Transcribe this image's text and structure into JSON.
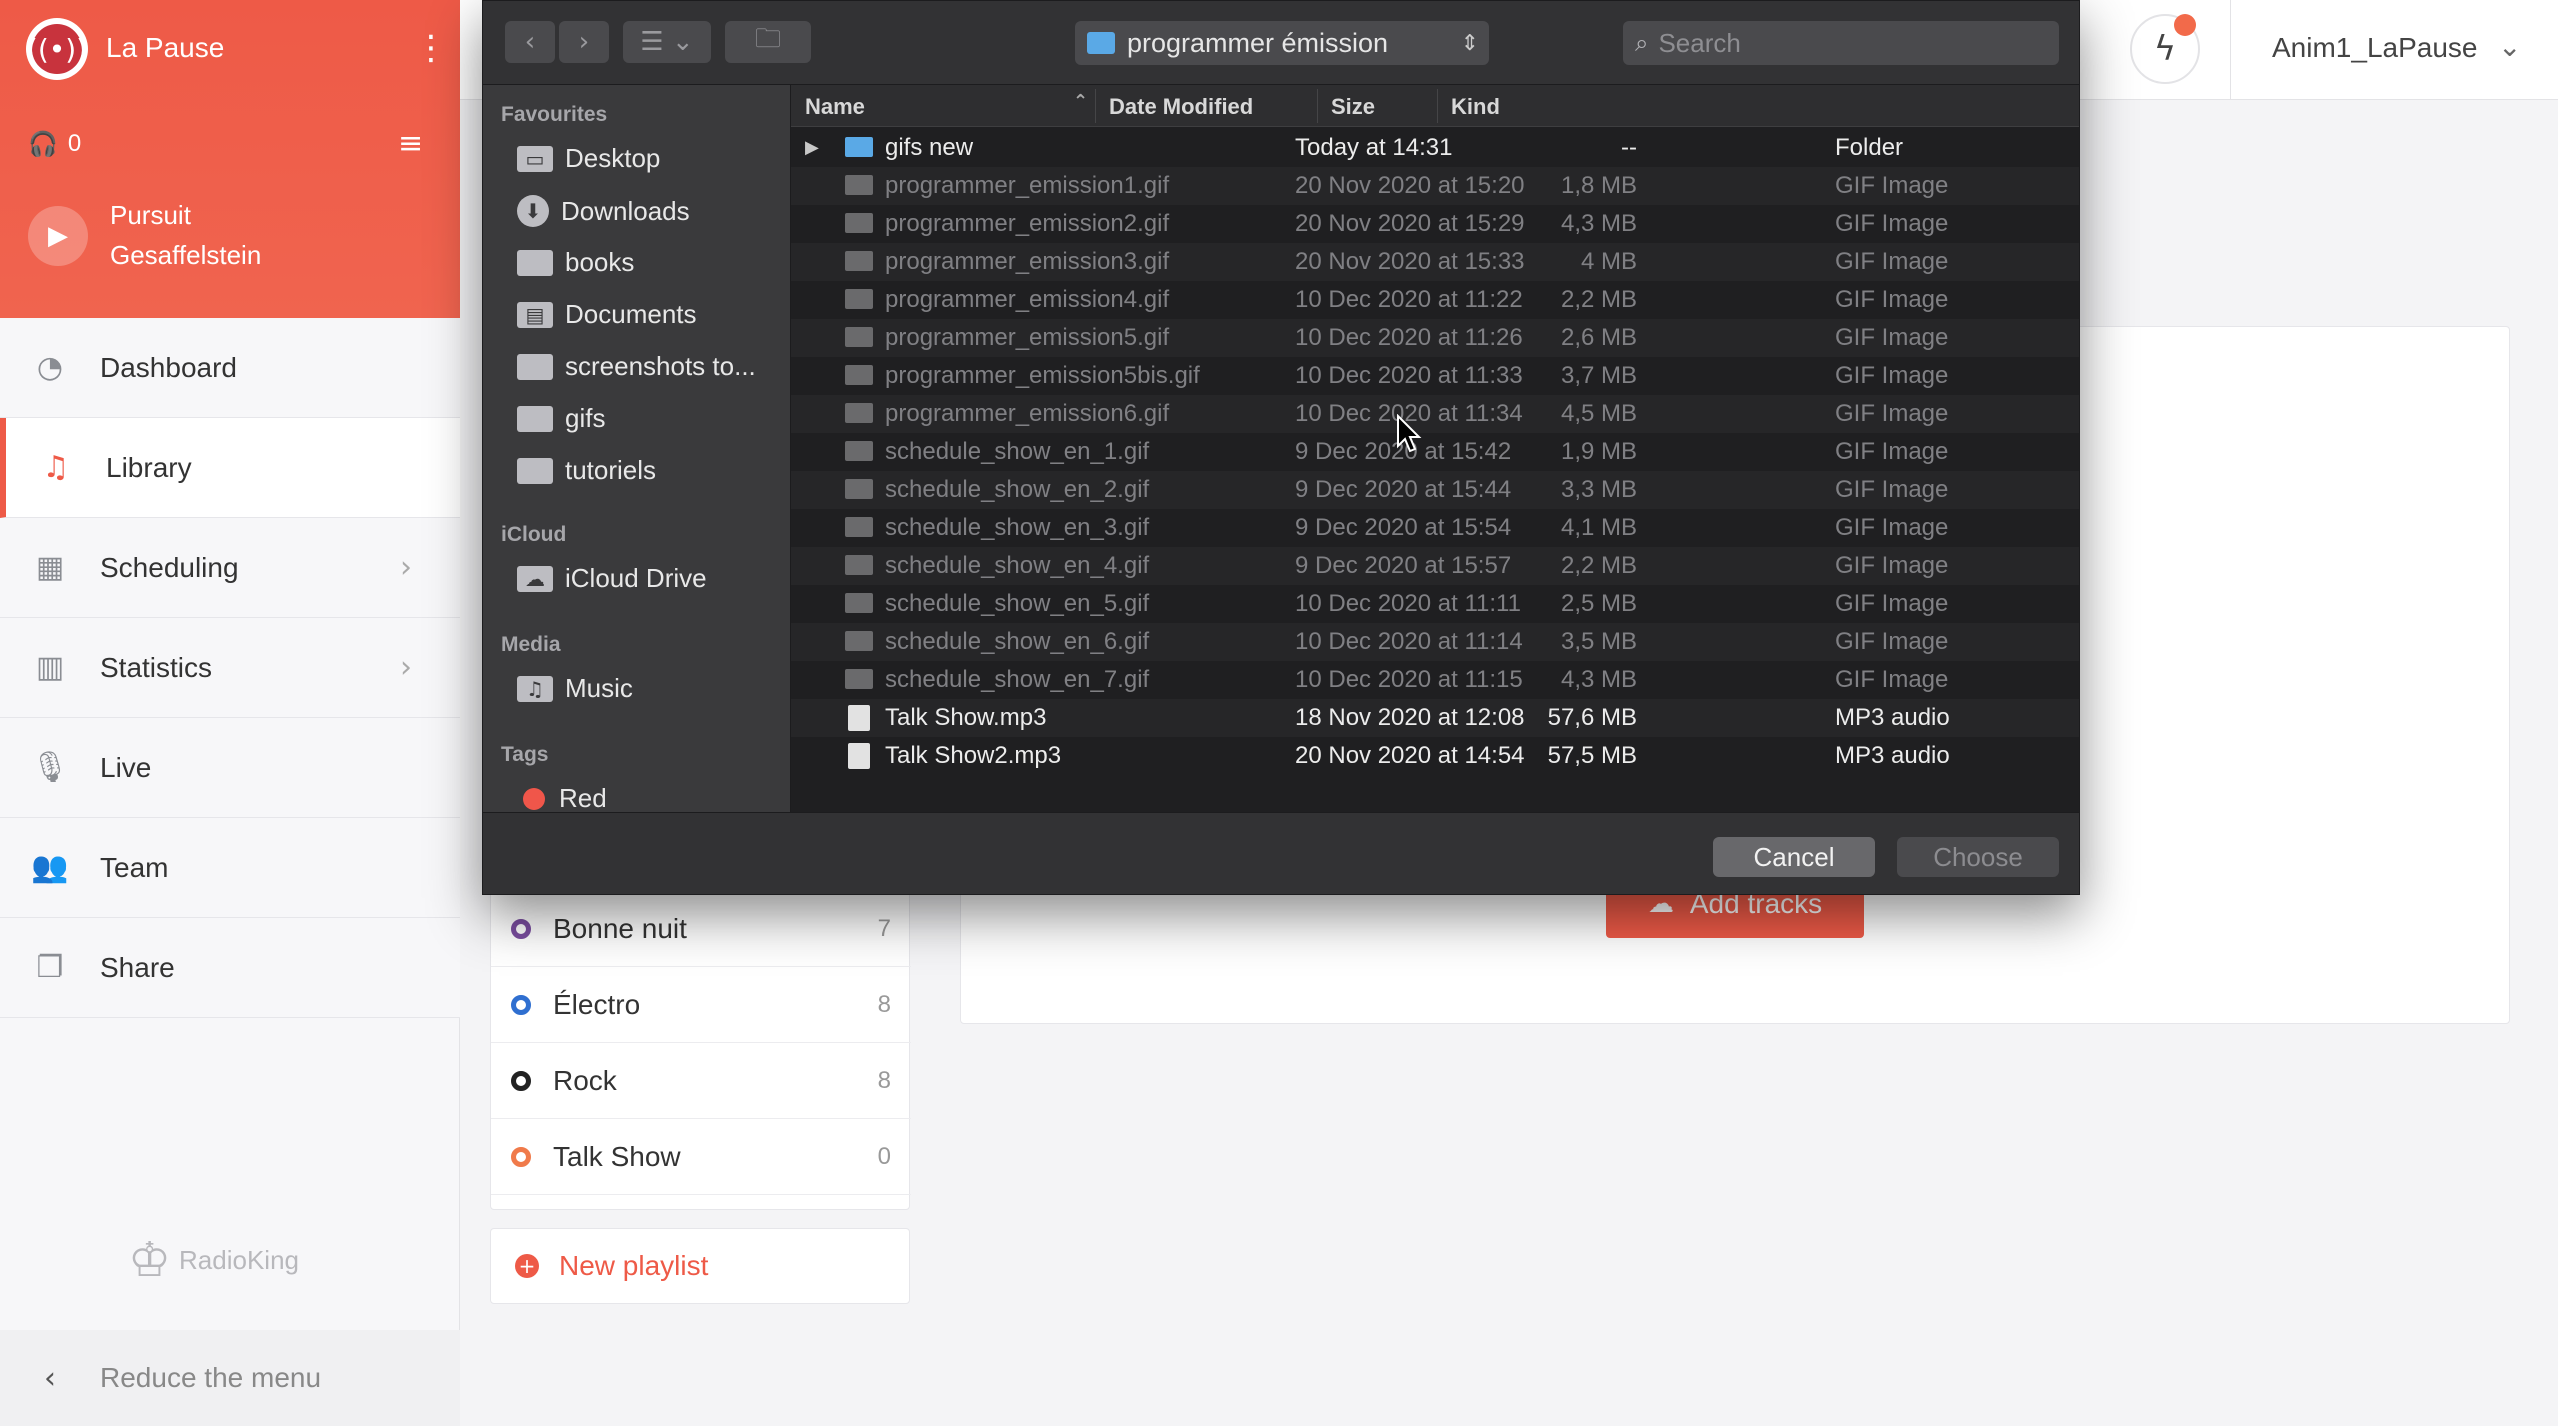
{
  "radio": {
    "name": "La Pause",
    "menu_icon": "⋮",
    "listeners": "0",
    "now_playing": {
      "title": "Pursuit",
      "artist": "Gesaffelstein"
    }
  },
  "sidebar": {
    "items": [
      {
        "label": "Dashboard",
        "icon": "gauge-icon",
        "glyph": "◔"
      },
      {
        "label": "Library",
        "icon": "music-note-icon",
        "glyph": "♫",
        "active": true
      },
      {
        "label": "Scheduling",
        "icon": "calendar-icon",
        "glyph": "▦",
        "chevron": true
      },
      {
        "label": "Statistics",
        "icon": "bar-chart-icon",
        "glyph": "▥",
        "chevron": true
      },
      {
        "label": "Live",
        "icon": "microphone-icon",
        "glyph": "🎙"
      },
      {
        "label": "Team",
        "icon": "users-icon",
        "glyph": "👥"
      },
      {
        "label": "Share",
        "icon": "share-icon",
        "glyph": "❐"
      }
    ],
    "brand": "RadioKing",
    "reduce_label": "Reduce the menu"
  },
  "topbar": {
    "user": "Anim1_LaPause"
  },
  "playlists": [
    {
      "name": "Bonne nuit",
      "count": "7",
      "color": "#7b4ea0"
    },
    {
      "name": "Électro",
      "count": "8",
      "color": "#2f6fd0"
    },
    {
      "name": "Rock",
      "count": "8",
      "color": "#222222"
    },
    {
      "name": "Talk Show",
      "count": "0",
      "color": "#f07a4a"
    }
  ],
  "new_playlist_label": "New playlist",
  "add_tracks_label": "Add tracks",
  "dialog": {
    "location": "programmer émission",
    "search_placeholder": "Search",
    "sidebar": {
      "favourites_title": "Favourites",
      "favourites": [
        "Desktop",
        "Downloads",
        "books",
        "Documents",
        "screenshots to...",
        "gifs",
        "tutoriels"
      ],
      "icloud_title": "iCloud",
      "icloud": [
        "iCloud Drive"
      ],
      "media_title": "Media",
      "media": [
        "Music"
      ],
      "tags_title": "Tags",
      "tags": [
        "Red"
      ]
    },
    "columns": {
      "name": "Name",
      "date": "Date Modified",
      "size": "Size",
      "kind": "Kind"
    },
    "files": [
      {
        "name": "gifs new",
        "date": "Today at 14:31",
        "size": "--",
        "kind": "Folder",
        "type": "folder",
        "enabled": true
      },
      {
        "name": "programmer_emission1.gif",
        "date": "20 Nov 2020 at 15:20",
        "size": "1,8 MB",
        "kind": "GIF Image",
        "type": "gif",
        "enabled": false
      },
      {
        "name": "programmer_emission2.gif",
        "date": "20 Nov 2020 at 15:29",
        "size": "4,3 MB",
        "kind": "GIF Image",
        "type": "gif",
        "enabled": false
      },
      {
        "name": "programmer_emission3.gif",
        "date": "20 Nov 2020 at 15:33",
        "size": "4 MB",
        "kind": "GIF Image",
        "type": "gif",
        "enabled": false
      },
      {
        "name": "programmer_emission4.gif",
        "date": "10 Dec 2020 at 11:22",
        "size": "2,2 MB",
        "kind": "GIF Image",
        "type": "gif",
        "enabled": false
      },
      {
        "name": "programmer_emission5.gif",
        "date": "10 Dec 2020 at 11:26",
        "size": "2,6 MB",
        "kind": "GIF Image",
        "type": "gif",
        "enabled": false
      },
      {
        "name": "programmer_emission5bis.gif",
        "date": "10 Dec 2020 at 11:33",
        "size": "3,7 MB",
        "kind": "GIF Image",
        "type": "gif",
        "enabled": false
      },
      {
        "name": "programmer_emission6.gif",
        "date": "10 Dec 2020 at 11:34",
        "size": "4,5 MB",
        "kind": "GIF Image",
        "type": "gif",
        "enabled": false
      },
      {
        "name": "schedule_show_en_1.gif",
        "date": "9 Dec 2020 at 15:42",
        "size": "1,9 MB",
        "kind": "GIF Image",
        "type": "gif",
        "enabled": false
      },
      {
        "name": "schedule_show_en_2.gif",
        "date": "9 Dec 2020 at 15:44",
        "size": "3,3 MB",
        "kind": "GIF Image",
        "type": "gif",
        "enabled": false
      },
      {
        "name": "schedule_show_en_3.gif",
        "date": "9 Dec 2020 at 15:54",
        "size": "4,1 MB",
        "kind": "GIF Image",
        "type": "gif",
        "enabled": false
      },
      {
        "name": "schedule_show_en_4.gif",
        "date": "9 Dec 2020 at 15:57",
        "size": "2,2 MB",
        "kind": "GIF Image",
        "type": "gif",
        "enabled": false
      },
      {
        "name": "schedule_show_en_5.gif",
        "date": "10 Dec 2020 at 11:11",
        "size": "2,5 MB",
        "kind": "GIF Image",
        "type": "gif",
        "enabled": false
      },
      {
        "name": "schedule_show_en_6.gif",
        "date": "10 Dec 2020 at 11:14",
        "size": "3,5 MB",
        "kind": "GIF Image",
        "type": "gif",
        "enabled": false
      },
      {
        "name": "schedule_show_en_7.gif",
        "date": "10 Dec 2020 at 11:15",
        "size": "4,3 MB",
        "kind": "GIF Image",
        "type": "gif",
        "enabled": false
      },
      {
        "name": "Talk Show.mp3",
        "date": "18 Nov 2020 at 12:08",
        "size": "57,6 MB",
        "kind": "MP3 audio",
        "type": "mp3",
        "enabled": true
      },
      {
        "name": "Talk Show2.mp3",
        "date": "20 Nov 2020 at 14:54",
        "size": "57,5 MB",
        "kind": "MP3 audio",
        "type": "mp3",
        "enabled": true
      }
    ],
    "cancel_label": "Cancel",
    "choose_label": "Choose"
  }
}
